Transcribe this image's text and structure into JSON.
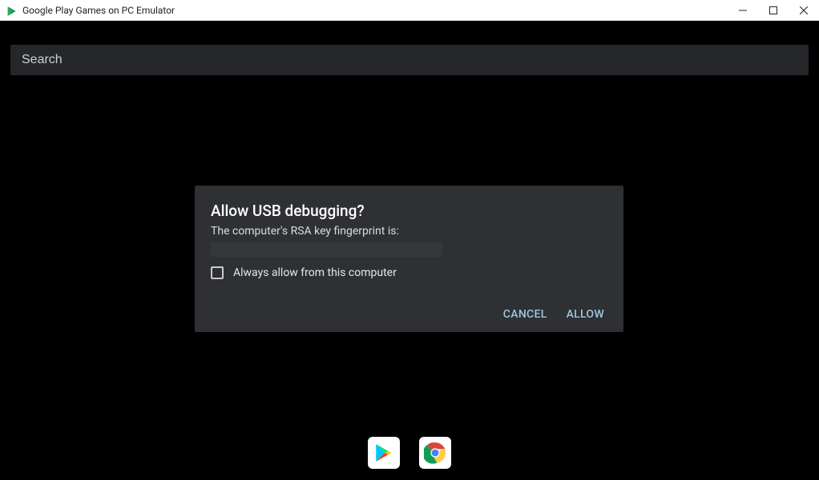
{
  "window": {
    "title": "Google Play Games on PC Emulator"
  },
  "search": {
    "placeholder": "Search"
  },
  "dialog": {
    "title": "Allow USB debugging?",
    "subtitle": "The computer's RSA key fingerprint is:",
    "checkbox_label": "Always allow from this computer",
    "cancel": "CANCEL",
    "allow": "ALLOW"
  },
  "dock": {
    "items": [
      "play-store",
      "chrome"
    ]
  }
}
